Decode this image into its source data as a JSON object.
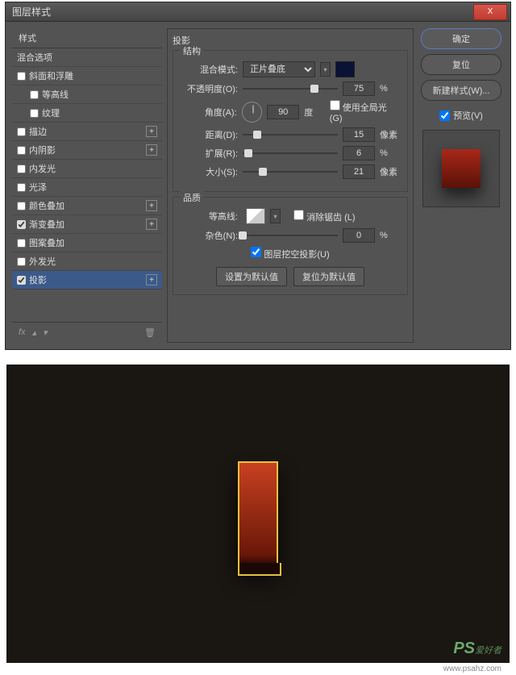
{
  "titlebar": {
    "title": "图层样式",
    "close": "X"
  },
  "left": {
    "header": "样式",
    "blend": "混合选项",
    "items": [
      {
        "label": "斜面和浮雕",
        "checked": false,
        "plus": false
      },
      {
        "label": "等高线",
        "checked": false,
        "plus": false,
        "indent": true
      },
      {
        "label": "纹理",
        "checked": false,
        "plus": false,
        "indent": true
      },
      {
        "label": "描边",
        "checked": false,
        "plus": true
      },
      {
        "label": "内阴影",
        "checked": false,
        "plus": true
      },
      {
        "label": "内发光",
        "checked": false,
        "plus": false
      },
      {
        "label": "光泽",
        "checked": false,
        "plus": false
      },
      {
        "label": "颜色叠加",
        "checked": false,
        "plus": true
      },
      {
        "label": "渐变叠加",
        "checked": true,
        "plus": true
      },
      {
        "label": "图案叠加",
        "checked": false,
        "plus": false
      },
      {
        "label": "外发光",
        "checked": false,
        "plus": false
      },
      {
        "label": "投影",
        "checked": true,
        "plus": true,
        "selected": true
      }
    ],
    "fx": "fx",
    "trash": "🗑"
  },
  "mid": {
    "title": "投影",
    "structure": "结构",
    "blendMode": {
      "label": "混合模式:",
      "value": "正片叠底"
    },
    "opacity": {
      "label": "不透明度(O):",
      "value": "75",
      "unit": "%",
      "pos": 75
    },
    "angle": {
      "label": "角度(A):",
      "value": "90",
      "unit": "度",
      "global": "使用全局光 (G)"
    },
    "distance": {
      "label": "距离(D):",
      "value": "15",
      "unit": "像素",
      "pos": 15
    },
    "spread": {
      "label": "扩展(R):",
      "value": "6",
      "unit": "%",
      "pos": 6
    },
    "size": {
      "label": "大小(S):",
      "value": "21",
      "unit": "像素",
      "pos": 21
    },
    "quality": "品质",
    "contour": {
      "label": "等高线:",
      "antialias": "消除锯齿 (L)"
    },
    "noise": {
      "label": "杂色(N):",
      "value": "0",
      "unit": "%",
      "pos": 0
    },
    "knockout": "图层挖空投影(U)",
    "btnDefault": "设置为默认值",
    "btnReset": "复位为默认值"
  },
  "right": {
    "ok": "确定",
    "cancel": "复位",
    "newStyle": "新建样式(W)...",
    "preview": "预览(V)"
  },
  "watermark": {
    "ps": "PS",
    "text": "爱好者",
    "url": "www.psahz.com"
  }
}
